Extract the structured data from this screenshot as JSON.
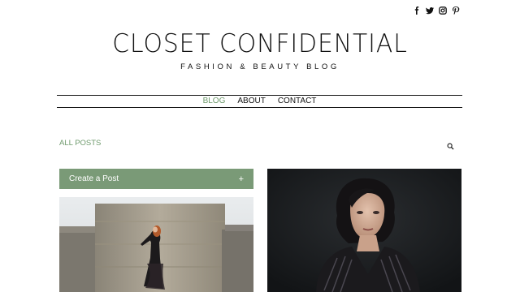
{
  "social": [
    {
      "icon": "facebook-icon"
    },
    {
      "icon": "twitter-icon"
    },
    {
      "icon": "instagram-icon"
    },
    {
      "icon": "pinterest-icon"
    }
  ],
  "header": {
    "title": "CLOSET CONFIDENTIAL",
    "tagline": "FASHION & BEAUTY BLOG"
  },
  "nav": {
    "items": [
      {
        "label": "BLOG",
        "active": true
      },
      {
        "label": "ABOUT",
        "active": false
      },
      {
        "label": "CONTACT",
        "active": false
      }
    ]
  },
  "posts_header": {
    "filter_label": "ALL POSTS",
    "search_icon": "search-icon"
  },
  "create_post": {
    "label": "Create a Post",
    "icon": "+"
  },
  "colors": {
    "accent": "#6e9a6c",
    "create_bar": "#7a9a77",
    "text": "#111111"
  }
}
